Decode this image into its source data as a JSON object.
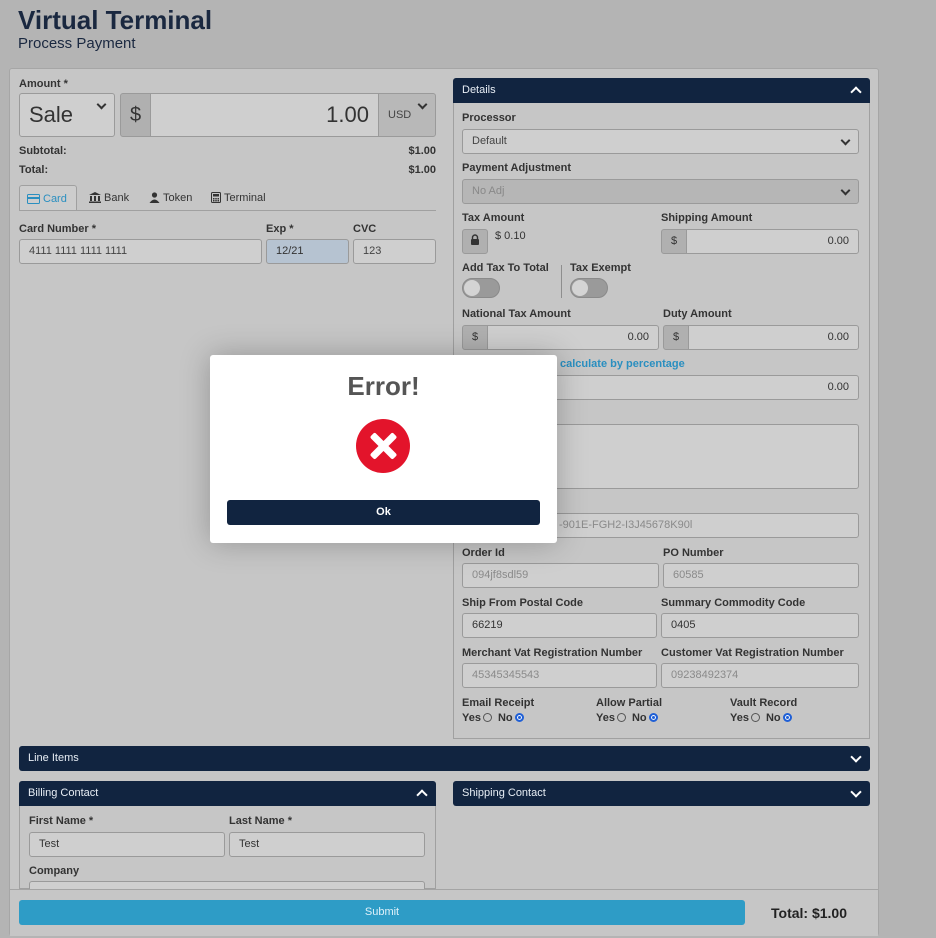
{
  "header": {
    "title": "Virtual Terminal",
    "subtitle": "Process Payment"
  },
  "amount": {
    "label": "Amount *",
    "type_selected": "Sale",
    "currency_symbol": "$",
    "value": "1.00",
    "currency": "USD"
  },
  "summary": {
    "subtotal_label": "Subtotal:",
    "subtotal_value": "$1.00",
    "total_label": "Total:",
    "total_value": "$1.00"
  },
  "tabs": [
    {
      "label": "Card",
      "icon": "card-icon"
    },
    {
      "label": "Bank",
      "icon": "bank-icon"
    },
    {
      "label": "Token",
      "icon": "user-icon"
    },
    {
      "label": "Terminal",
      "icon": "terminal-icon"
    }
  ],
  "card": {
    "number_label": "Card Number *",
    "number_value": "4111 1111 1111 1111",
    "exp_label": "Exp *",
    "exp_value": "12/21",
    "cvc_label": "CVC",
    "cvc_value": "123"
  },
  "details": {
    "title": "Details",
    "processor_label": "Processor",
    "processor_value": "Default",
    "adjustment_label": "Payment Adjustment",
    "adjustment_value": "No Adj",
    "tax_label": "Tax Amount",
    "tax_value": "$ 0.10",
    "shipping_label": "Shipping Amount",
    "shipping_symbol": "$",
    "shipping_value": "0.00",
    "add_tax_label": "Add Tax To Total",
    "tax_exempt_label": "Tax Exempt",
    "national_tax_label": "National Tax Amount",
    "national_tax_symbol": "$",
    "national_tax_value": "0.00",
    "duty_label": "Duty Amount",
    "duty_symbol": "$",
    "duty_value": "0.00",
    "percentage_link": "calculate by percentage",
    "discount_value": "0.00",
    "invoice_partial": "-901E-FGH2-I3J45678K90l",
    "order_id_label": "Order Id",
    "order_id_value": "094jf8sdl59",
    "po_label": "PO Number",
    "po_value": "60585",
    "ship_postal_label": "Ship From Postal Code",
    "ship_postal_value": "66219",
    "commodity_label": "Summary Commodity Code",
    "commodity_value": "0405",
    "merchant_vat_label": "Merchant Vat Registration Number",
    "merchant_vat_value": "45345345543",
    "customer_vat_label": "Customer Vat Registration Number",
    "customer_vat_value": "09238492374",
    "email_receipt_label": "Email Receipt",
    "allow_partial_label": "Allow Partial",
    "vault_record_label": "Vault Record",
    "yes": "Yes",
    "no": "No"
  },
  "line_items": {
    "title": "Line Items"
  },
  "billing": {
    "title": "Billing Contact",
    "first_label": "First Name *",
    "first_value": "Test",
    "last_label": "Last Name *",
    "last_value": "Test",
    "company_label": "Company"
  },
  "shipping": {
    "title": "Shipping Contact"
  },
  "footer": {
    "submit_label": "Submit",
    "total_label": "Total: $1.00"
  },
  "modal": {
    "title": "Error!",
    "ok_label": "Ok",
    "icon": "error-icon"
  }
}
